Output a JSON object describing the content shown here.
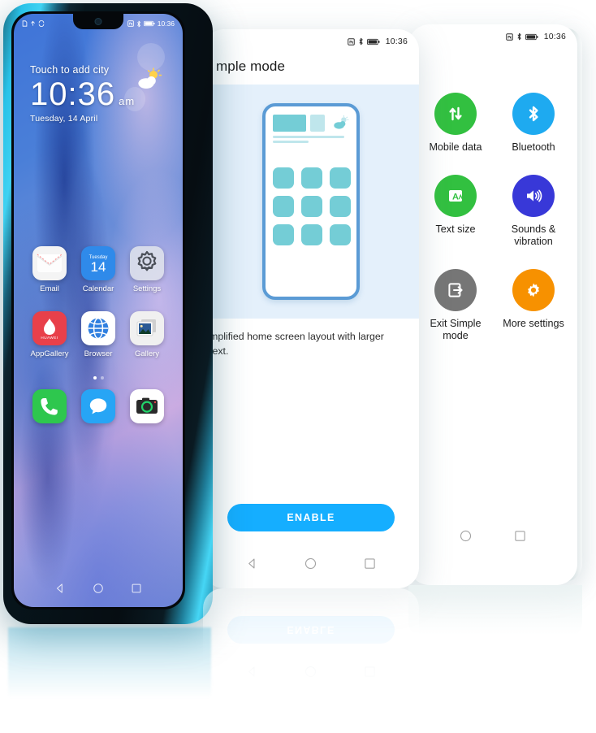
{
  "left_phone": {
    "status_bar": {
      "left_icons": [
        "document-icon",
        "upload-icon",
        "sync-icon"
      ],
      "right_icons": [
        "nfc-icon",
        "bluetooth-icon",
        "battery-icon"
      ],
      "time": "10:36"
    },
    "lock": {
      "city_prompt": "Touch to add city",
      "time": "10:36",
      "ampm": "am",
      "date": "Tuesday, 14 April",
      "weather_icon": "partly-cloudy-icon"
    },
    "apps_row1": [
      {
        "label": "Email",
        "icon": "email-icon"
      },
      {
        "label": "Calendar",
        "icon": "calendar-icon",
        "weekday": "Tuesday",
        "day": "14"
      },
      {
        "label": "Settings",
        "icon": "gear-icon"
      }
    ],
    "apps_row2": [
      {
        "label": "AppGallery",
        "icon": "huawei-appgallery-icon"
      },
      {
        "label": "Browser",
        "icon": "browser-globe-icon"
      },
      {
        "label": "Gallery",
        "icon": "gallery-photo-icon"
      }
    ],
    "dock": [
      {
        "label": "Phone",
        "icon": "phone-handset-icon"
      },
      {
        "label": "Messages",
        "icon": "message-bubble-icon"
      },
      {
        "label": "Camera",
        "icon": "camera-icon"
      }
    ],
    "page_dots": 2,
    "active_dot": 1,
    "nav_bar": [
      "back-icon",
      "home-icon",
      "recents-icon"
    ]
  },
  "mid_phone": {
    "status_bar": {
      "right_icons": [
        "nfc-icon",
        "bluetooth-icon",
        "battery-icon"
      ],
      "time": "10:36"
    },
    "title": "mple mode",
    "illustration": {
      "name": "simple-mode-home-preview",
      "grid_cells": 9,
      "weather_icon": "partly-cloudy-icon"
    },
    "description": "mplified home screen layout with larger\n text.",
    "enable_button": "ENABLE",
    "nav_bar": [
      "back-icon",
      "home-icon",
      "recents-icon"
    ],
    "accent_color": "#15aeff",
    "illustration_bg": "#e4f0fb"
  },
  "right_phone": {
    "status_bar": {
      "right_icons": [
        "nfc-icon",
        "bluetooth-icon",
        "battery-icon"
      ],
      "time": "10:36"
    },
    "tiles": [
      {
        "label": "Mobile data",
        "icon": "mobile-data-icon",
        "color": "#32c040"
      },
      {
        "label": "Bluetooth",
        "icon": "bluetooth-icon",
        "color": "#1eaaf0"
      },
      {
        "label": "Text size",
        "icon": "text-size-icon",
        "color": "#32c040"
      },
      {
        "label": "Sounds & vibration",
        "icon": "speaker-icon",
        "color": "#3838d8"
      },
      {
        "label": "Exit Simple mode",
        "icon": "exit-icon",
        "color": "#767676"
      },
      {
        "label": "More settings",
        "icon": "gear-icon",
        "color": "#f79100"
      }
    ],
    "nav_bar": [
      "home-icon",
      "recents-icon"
    ]
  },
  "reflection": {
    "enable_button": "ENABLE",
    "nav_bar": [
      "back-icon",
      "home-icon",
      "recents-icon"
    ]
  }
}
